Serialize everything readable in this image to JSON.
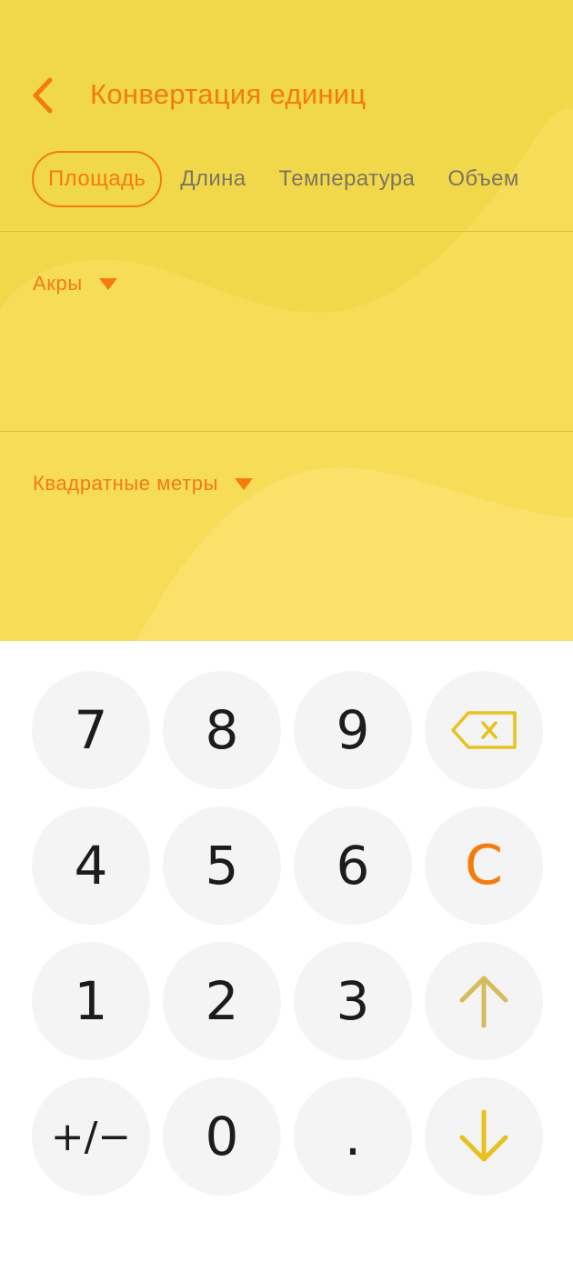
{
  "header": {
    "title": "Конвертация единиц"
  },
  "tabs": [
    {
      "label": "Площадь",
      "active": true
    },
    {
      "label": "Длина",
      "active": false
    },
    {
      "label": "Температура",
      "active": false
    },
    {
      "label": "Объем",
      "active": false
    }
  ],
  "converter": {
    "from_unit": "Акры",
    "to_unit": "Квадратные метры"
  },
  "keypad": {
    "keys": [
      "7",
      "8",
      "9",
      "backspace-icon",
      "4",
      "5",
      "6",
      "C",
      "1",
      "2",
      "3",
      "arrow-up-icon",
      "+/−",
      "0",
      ".",
      "arrow-down-icon"
    ]
  },
  "colors": {
    "accent": "#f47b0e",
    "background_yellow": "#f1d84b",
    "wave_light": "#f9df5d",
    "key_background": "#f4f4f4",
    "arrow_up": "#d4bc5e",
    "arrow_down": "#e8c11f",
    "backspace": "#e8c11f"
  }
}
